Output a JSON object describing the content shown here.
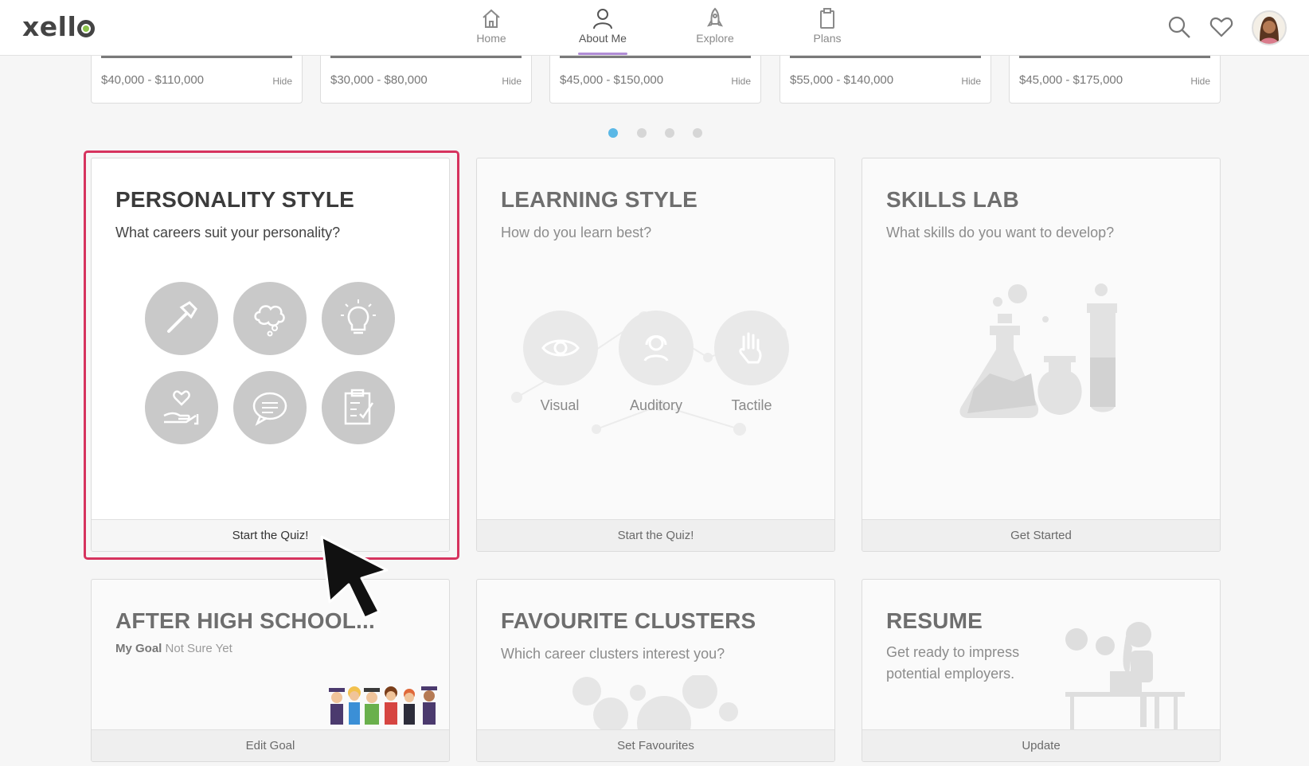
{
  "header": {
    "logo": "xell",
    "nav": [
      {
        "label": "Home",
        "icon": "home-icon"
      },
      {
        "label": "About Me",
        "icon": "person-icon"
      },
      {
        "label": "Explore",
        "icon": "rocket-icon"
      },
      {
        "label": "Plans",
        "icon": "clipboard-icon"
      }
    ],
    "active_nav": "About Me",
    "icons": [
      "search-icon",
      "heart-icon",
      "avatar"
    ]
  },
  "salary_cards": [
    {
      "range": "$40,000 - $110,000",
      "hide_label": "Hide"
    },
    {
      "range": "$30,000 - $80,000",
      "hide_label": "Hide"
    },
    {
      "range": "$45,000 - $150,000",
      "hide_label": "Hide"
    },
    {
      "range": "$55,000 - $140,000",
      "hide_label": "Hide"
    },
    {
      "range": "$45,000 - $175,000",
      "hide_label": "Hide"
    }
  ],
  "carousel": {
    "pages": 4,
    "active_page": 1
  },
  "tiles": {
    "personality": {
      "title": "PERSONALITY STYLE",
      "subtitle": "What careers suit your personality?",
      "action": "Start the Quiz!"
    },
    "learning": {
      "title": "LEARNING STYLE",
      "subtitle": "How do you learn best?",
      "action": "Start the Quiz!",
      "styles": [
        "Visual",
        "Auditory",
        "Tactile"
      ]
    },
    "skills": {
      "title": "SKILLS LAB",
      "subtitle": "What skills do you want to develop?",
      "action": "Get Started"
    },
    "after_high_school": {
      "title": "AFTER HIGH SCHOOL...",
      "goal_label": "My Goal",
      "goal_value": "Not Sure Yet",
      "action": "Edit Goal"
    },
    "clusters": {
      "title": "FAVOURITE CLUSTERS",
      "subtitle": "Which career clusters interest you?",
      "action": "Set Favourites"
    },
    "resume": {
      "title": "RESUME",
      "subtitle_line1": "Get ready to impress",
      "subtitle_line2": "potential employers.",
      "action": "Update"
    }
  },
  "colors": {
    "accent_underline": "#b08cd6",
    "highlight": "#d6335e",
    "active_dot": "#5bb8e6",
    "logo_dot": "#8bc34a"
  }
}
